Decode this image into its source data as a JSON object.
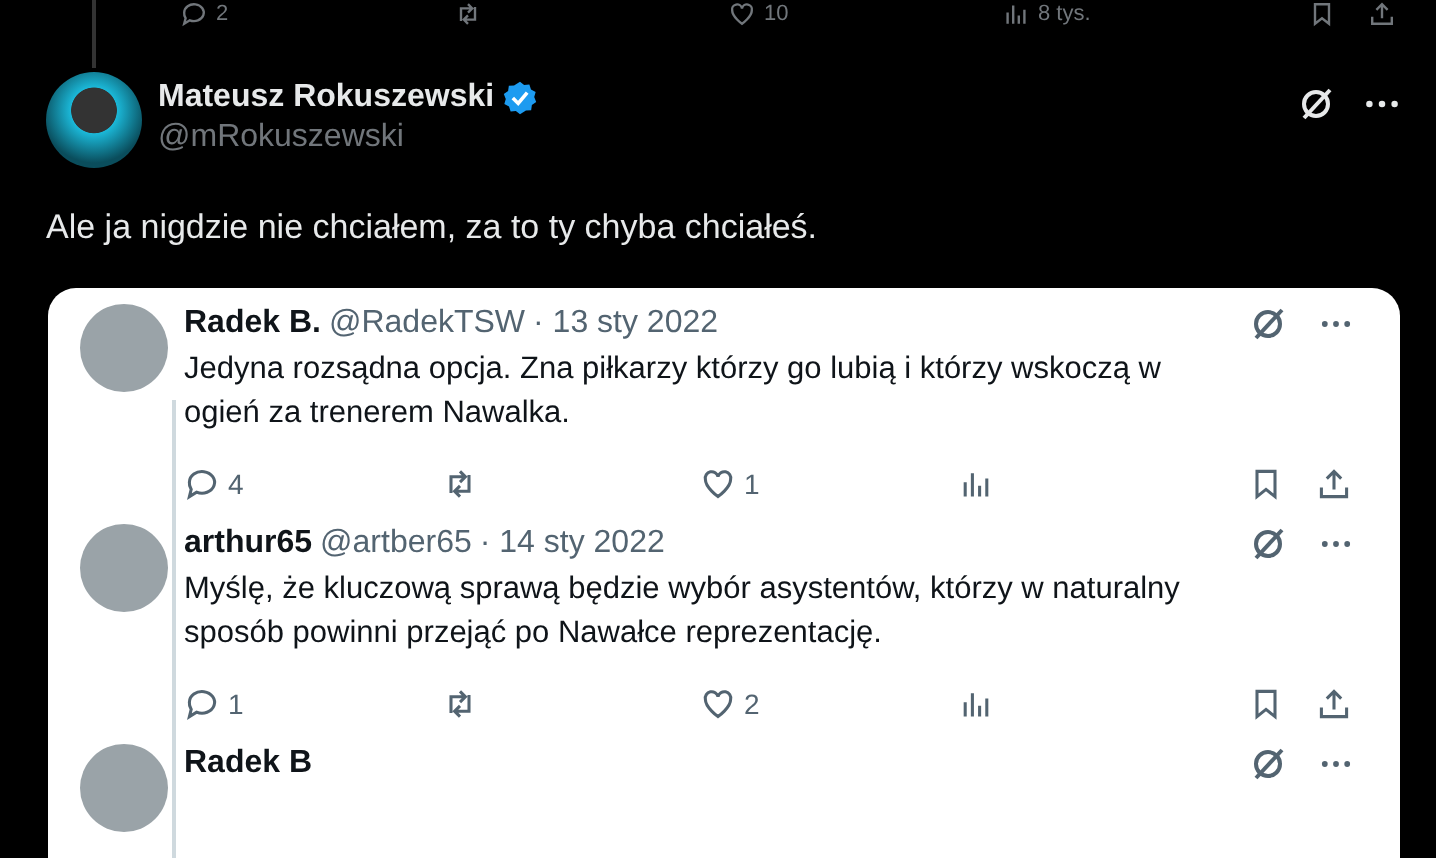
{
  "thread_actions": [
    {
      "kind": "reply",
      "count": "2"
    },
    {
      "kind": "repost"
    },
    {
      "kind": "like",
      "count": "10"
    },
    {
      "kind": "views",
      "count": "8 tys."
    },
    {
      "kind": "bookmark"
    },
    {
      "kind": "share"
    }
  ],
  "tweet": {
    "author": {
      "name": "Mateusz Rokuszewski",
      "handle": "@mRokuszewski",
      "verified": true
    },
    "text": "Ale ja nigdzie nie chciałem, za to ty chyba chciałeś.",
    "quoted": {
      "replies": [
        {
          "name": "Radek B.",
          "handle": "@RadekTSW",
          "date": "· 13 sty 2022",
          "text": "Jedyna rozsądna opcja. Zna piłkarzy którzy go lubią i którzy wskoczą w ogień za trenerem Nawalka.",
          "actions": [
            {
              "kind": "reply",
              "count": "4"
            },
            {
              "kind": "repost"
            },
            {
              "kind": "like",
              "count": "1"
            },
            {
              "kind": "views"
            },
            {
              "kind": "bookmark"
            },
            {
              "kind": "share"
            }
          ]
        },
        {
          "name": "arthur65",
          "handle": "@artber65",
          "date": "· 14 sty 2022",
          "text": "Myślę, że kluczową sprawą będzie wybór asystentów, którzy w naturalny sposób powinni przejąć po Nawałce reprezentację.",
          "actions": [
            {
              "kind": "reply",
              "count": "1"
            },
            {
              "kind": "repost"
            },
            {
              "kind": "like",
              "count": "2"
            },
            {
              "kind": "views"
            },
            {
              "kind": "bookmark"
            },
            {
              "kind": "share"
            }
          ]
        },
        {
          "name": "Radek B"
        }
      ]
    }
  }
}
